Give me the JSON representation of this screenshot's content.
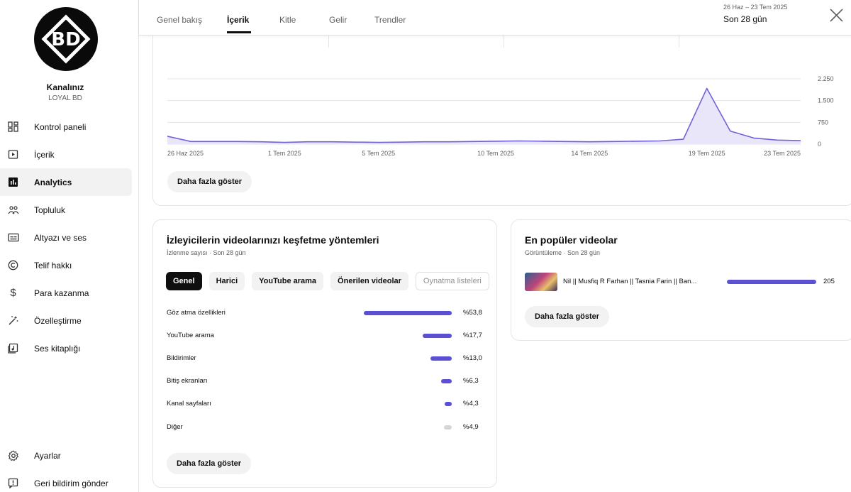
{
  "sidebar": {
    "avatar_text": "BD",
    "channel_title": "Kanalınız",
    "channel_name": "LOYAL BD",
    "items": [
      {
        "label": "Kontrol paneli",
        "icon": "dashboard-icon"
      },
      {
        "label": "İçerik",
        "icon": "content-icon"
      },
      {
        "label": "Analytics",
        "icon": "analytics-icon",
        "active": true
      },
      {
        "label": "Topluluk",
        "icon": "community-icon"
      },
      {
        "label": "Altyazı ve ses",
        "icon": "subtitles-icon"
      },
      {
        "label": "Telif hakkı",
        "icon": "copyright-icon"
      },
      {
        "label": "Para kazanma",
        "icon": "dollar-icon"
      },
      {
        "label": "Özelleştirme",
        "icon": "magic-wand-icon"
      },
      {
        "label": "Ses kitaplığı",
        "icon": "audio-library-icon"
      }
    ],
    "bottom_items": [
      {
        "label": "Ayarlar",
        "icon": "gear-icon"
      },
      {
        "label": "Geri bildirim gönder",
        "icon": "feedback-icon"
      }
    ]
  },
  "topbar": {
    "tabs": [
      "Genel bakış",
      "İçerik",
      "Kitle",
      "Gelir",
      "Trendler"
    ],
    "active_tab": "İçerik",
    "date_range": "26 Haz – 23 Tem 2025",
    "date_label": "Son 28 gün"
  },
  "chart_card": {
    "more_button": "Daha fazla göster"
  },
  "chart_data": {
    "type": "area",
    "x": [
      "26 Haz 2025",
      "27 Haz 2025",
      "28 Haz 2025",
      "29 Haz 2025",
      "30 Haz 2025",
      "1 Tem 2025",
      "2 Tem 2025",
      "3 Tem 2025",
      "4 Tem 2025",
      "5 Tem 2025",
      "6 Tem 2025",
      "7 Tem 2025",
      "8 Tem 2025",
      "9 Tem 2025",
      "10 Tem 2025",
      "11 Tem 2025",
      "12 Tem 2025",
      "13 Tem 2025",
      "14 Tem 2025",
      "15 Tem 2025",
      "16 Tem 2025",
      "17 Tem 2025",
      "18 Tem 2025",
      "19 Tem 2025",
      "20 Tem 2025",
      "21 Tem 2025",
      "22 Tem 2025",
      "23 Tem 2025"
    ],
    "values": [
      270,
      90,
      90,
      90,
      80,
      60,
      80,
      80,
      70,
      60,
      70,
      80,
      80,
      90,
      100,
      110,
      100,
      90,
      80,
      90,
      100,
      110,
      170,
      1920,
      450,
      210,
      140,
      120
    ],
    "xticks": [
      "26 Haz 2025",
      "1 Tem 2025",
      "5 Tem 2025",
      "10 Tem 2025",
      "14 Tem 2025",
      "19 Tem 2025",
      "23 Tem 2025"
    ],
    "yticks": [
      "0",
      "750",
      "1.500",
      "2.250"
    ],
    "ytick_values": [
      0,
      750,
      1500,
      2250
    ],
    "ylim": [
      0,
      2250
    ],
    "grid": true,
    "line_color": "#6f63d9",
    "fill_color": "#e9e6fa"
  },
  "sources": {
    "title": "İzleyicilerin videolarınızı keşfetme yöntemleri",
    "subtitle": "İzlenme sayısı · Son 28 gün",
    "chips": [
      {
        "label": "Genel",
        "state": "active"
      },
      {
        "label": "Harici",
        "state": "normal"
      },
      {
        "label": "YouTube arama",
        "state": "normal"
      },
      {
        "label": "Önerilen videolar",
        "state": "normal"
      },
      {
        "label": "Oynatma listeleri",
        "state": "disabled"
      }
    ],
    "rows": [
      {
        "label": "Göz atma özellikleri",
        "pct": "%53,8",
        "value": 53.8
      },
      {
        "label": "YouTube arama",
        "pct": "%17,7",
        "value": 17.7
      },
      {
        "label": "Bildirimler",
        "pct": "%13,0",
        "value": 13.0
      },
      {
        "label": "Bitiş ekranları",
        "pct": "%6,3",
        "value": 6.3
      },
      {
        "label": "Kanal sayfaları",
        "pct": "%4,3",
        "value": 4.3
      },
      {
        "label": "Diğer",
        "pct": "%4,9",
        "value": 4.9,
        "grey": true
      }
    ],
    "more_button": "Daha fazla göster",
    "bar_color": "#5b4fd4"
  },
  "top_videos": {
    "title": "En popüler videolar",
    "subtitle": "Görüntüleme · Son 28 gün",
    "videos": [
      {
        "title": "Nil || Musfiq R Farhan || Tasnia Farin || Ban...",
        "views": "205"
      }
    ],
    "more_button": "Daha fazla göster"
  }
}
